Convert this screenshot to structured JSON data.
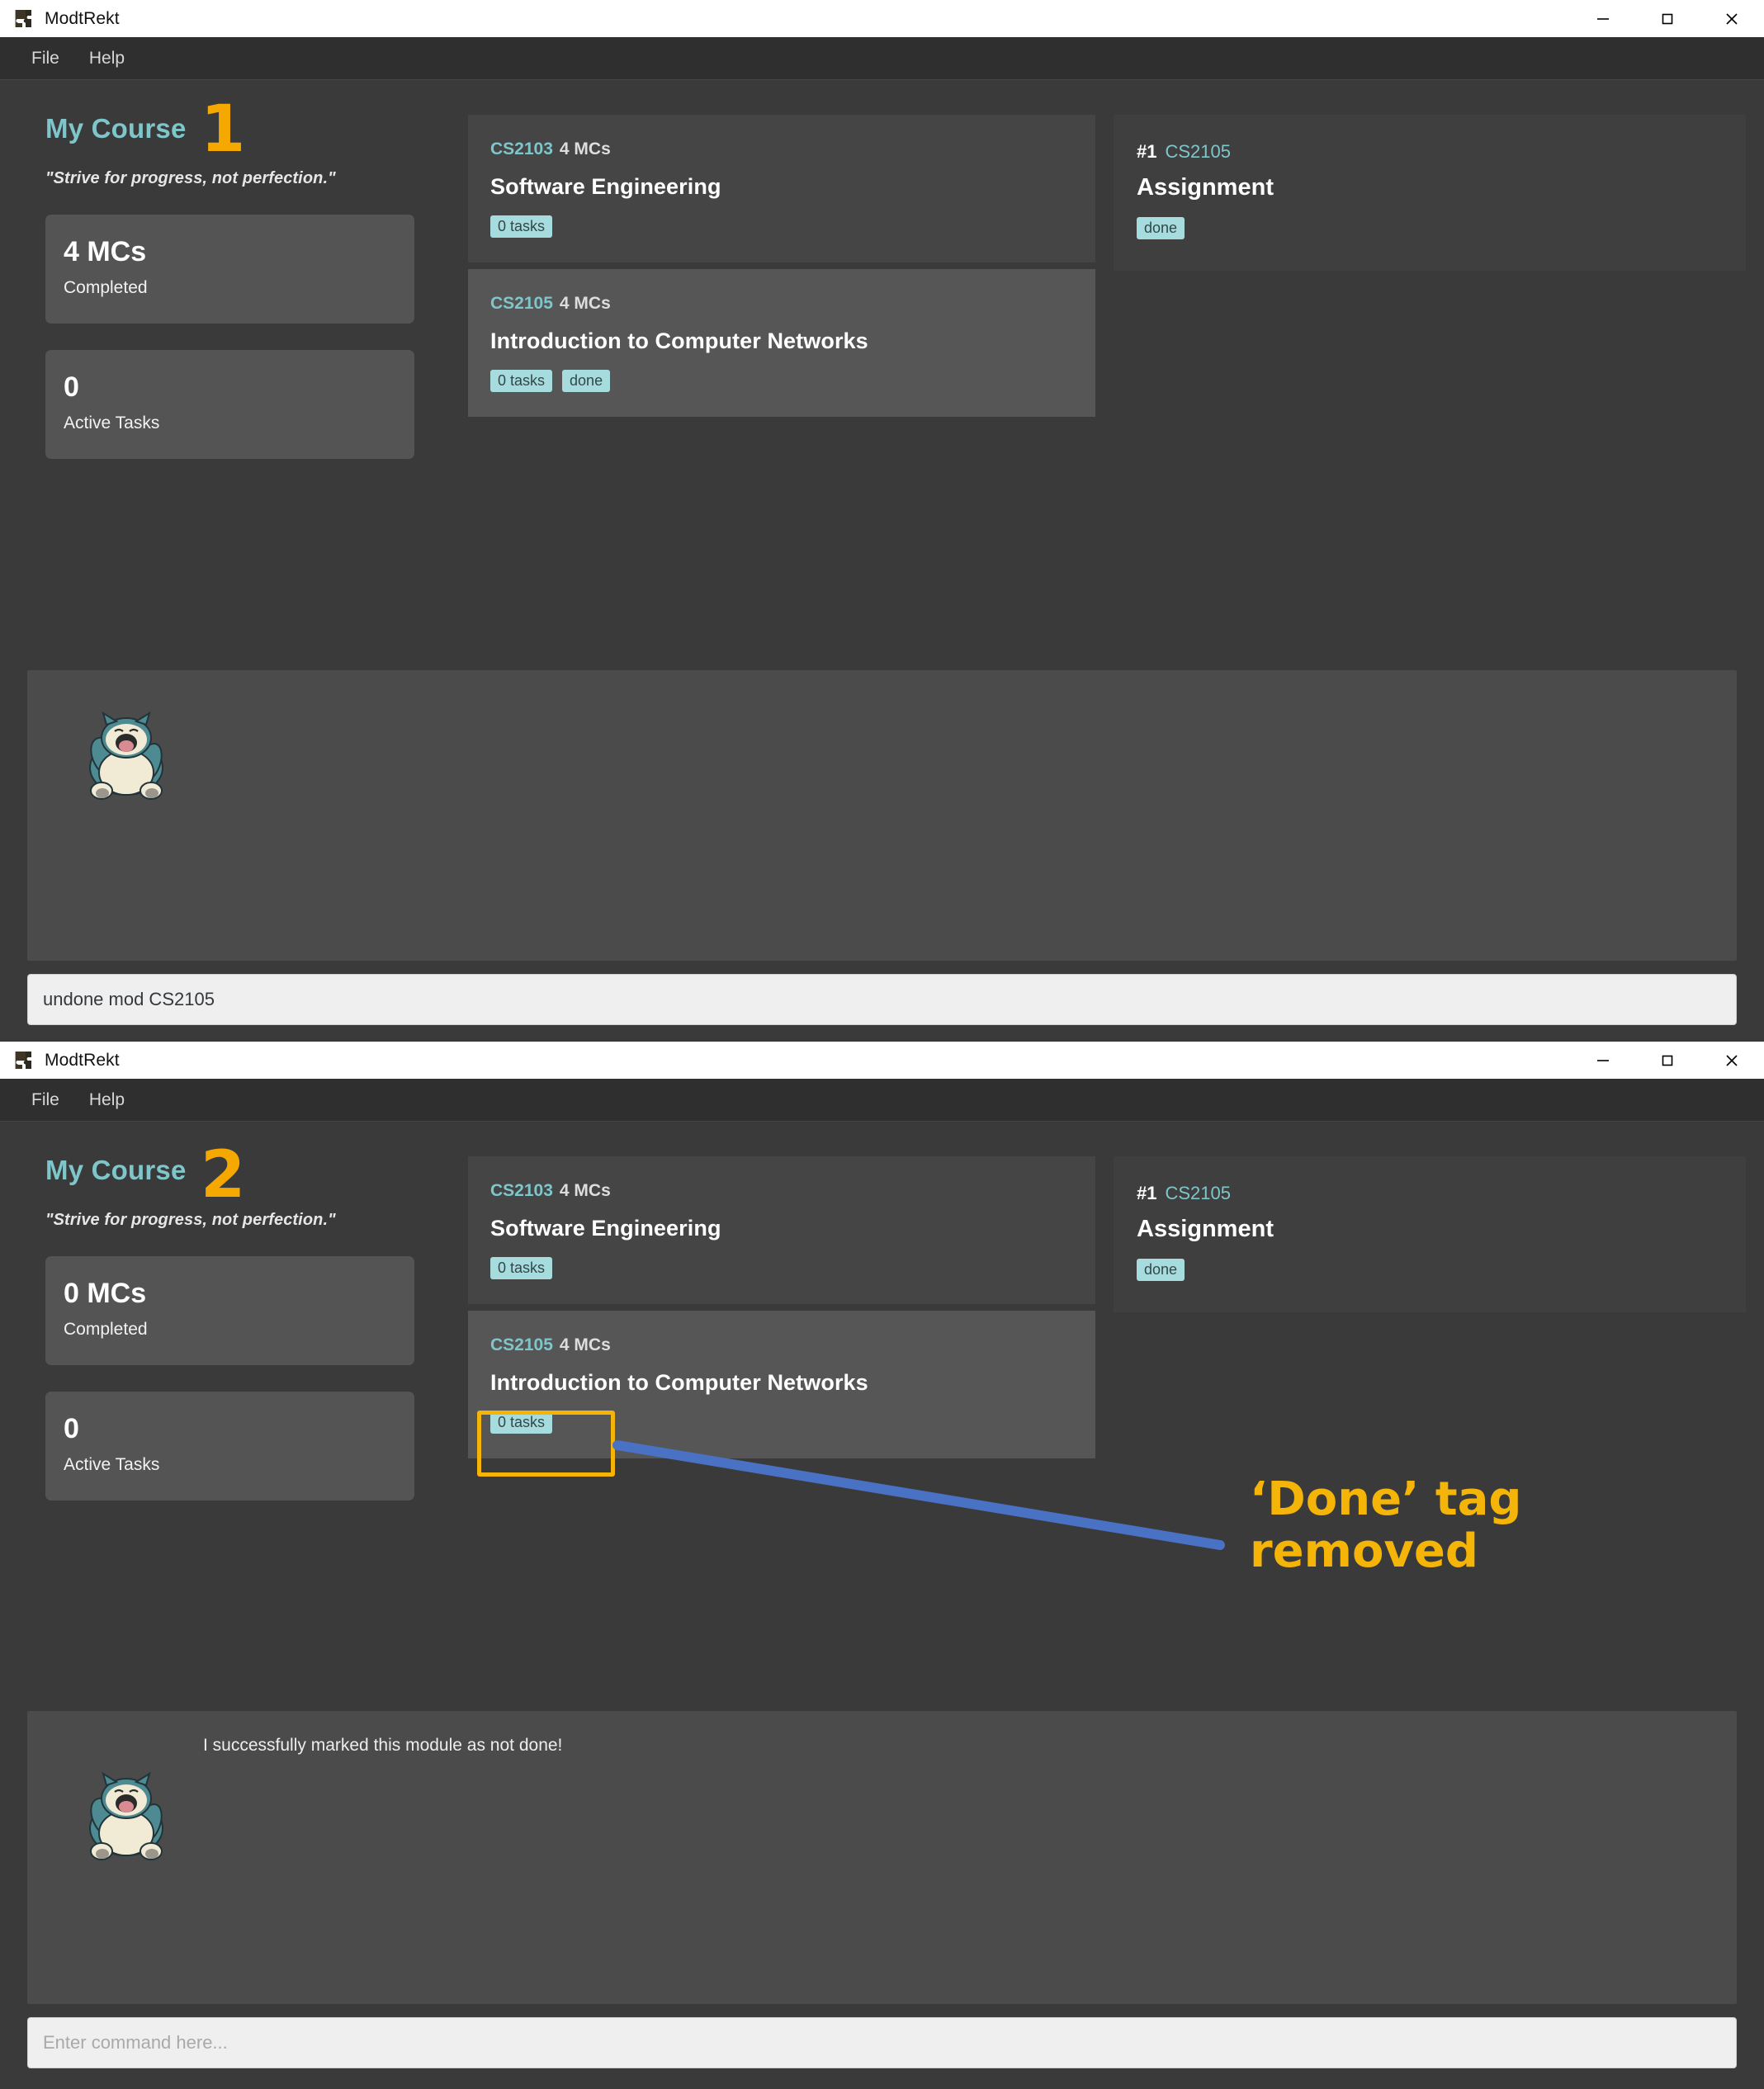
{
  "app": {
    "title": "ModtRekt",
    "icon": "puzzle-piece-icon",
    "menus": [
      "File",
      "Help"
    ],
    "window_controls": {
      "minimize": "minimize-icon",
      "maximize": "maximize-icon",
      "close": "close-icon"
    }
  },
  "colors": {
    "accent_teal": "#7fc6cb",
    "tag_bg": "#a6dcdd",
    "annotation_orange": "#f5b408",
    "leader_blue": "#4a72c4",
    "window_bg": "#3a3a3a",
    "card_bg": "#454545",
    "card_bg_alt": "#565656",
    "stat_bg": "#545454"
  },
  "screens": [
    {
      "step": "1",
      "header": {
        "title": "My Course",
        "quote": "\"Strive for progress, not perfection.\""
      },
      "stats": [
        {
          "value": "4 MCs",
          "label": "Completed"
        },
        {
          "value": "0",
          "label": "Active Tasks"
        }
      ],
      "modules": [
        {
          "code": "CS2103",
          "mcs": "4 MCs",
          "name": "Software Engineering",
          "tags": [
            "0 tasks"
          ],
          "highlighted": false
        },
        {
          "code": "CS2105",
          "mcs": "4 MCs",
          "name": "Introduction to Computer Networks",
          "tags": [
            "0 tasks",
            "done"
          ],
          "highlighted": true
        }
      ],
      "tasks": [
        {
          "number": "#1",
          "code": "CS2105",
          "name": "Assignment",
          "tags": [
            "done"
          ]
        }
      ],
      "chat": {
        "message": "",
        "avatar": "snorlax-avatar"
      },
      "command": {
        "value": "undone mod CS2105",
        "placeholder": "Enter command here..."
      }
    },
    {
      "step": "2",
      "header": {
        "title": "My Course",
        "quote": "\"Strive for progress, not perfection.\""
      },
      "stats": [
        {
          "value": "0 MCs",
          "label": "Completed"
        },
        {
          "value": "0",
          "label": "Active Tasks"
        }
      ],
      "modules": [
        {
          "code": "CS2103",
          "mcs": "4 MCs",
          "name": "Software Engineering",
          "tags": [
            "0 tasks"
          ],
          "highlighted": false
        },
        {
          "code": "CS2105",
          "mcs": "4 MCs",
          "name": "Introduction to Computer Networks",
          "tags": [
            "0 tasks"
          ],
          "highlighted": true
        }
      ],
      "tasks": [
        {
          "number": "#1",
          "code": "CS2105",
          "name": "Assignment",
          "tags": [
            "done"
          ]
        }
      ],
      "chat": {
        "message": "I successfully marked this module as not done!",
        "avatar": "snorlax-avatar"
      },
      "command": {
        "value": "",
        "placeholder": "Enter command here..."
      }
    }
  ],
  "annotations": {
    "callout_line1": "‘Done’ tag",
    "callout_line2": "removed"
  }
}
